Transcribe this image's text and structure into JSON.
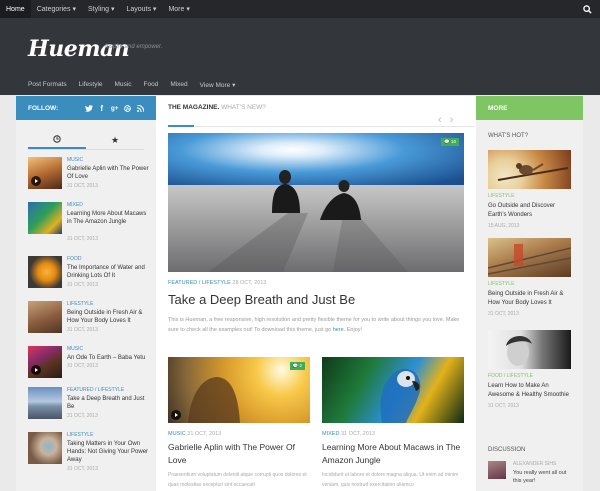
{
  "topnav": {
    "items": [
      {
        "label": "Home",
        "active": true
      },
      {
        "label": "Categories ▾"
      },
      {
        "label": "Styling ▾"
      },
      {
        "label": "Layouts ▾"
      },
      {
        "label": "More ▾"
      }
    ]
  },
  "header": {
    "logo": "Hueman",
    "tagline": "Inspire and empower.",
    "subnav": [
      "Post Formats",
      "Lifestyle",
      "Music",
      "Food",
      "Mixed",
      "View More ▾"
    ]
  },
  "left": {
    "follow_label": "FOLLOW:",
    "posts": [
      {
        "cat": "Music",
        "title": "Gabrielle Aplin with The Power Of Love",
        "date": "31 OCT, 2013",
        "video": true
      },
      {
        "cat": "Mixed",
        "title": "Learning More About Macaws in The Amazon Jungle",
        "date": "31 OCT, 2013"
      },
      {
        "cat": "Food",
        "title": "The Importance of Water and Drinking Lots Of It",
        "date": "31 OCT, 2013"
      },
      {
        "cat": "Lifestyle",
        "title": "Being Outside in Fresh Air & How Your Body Loves It",
        "date": "31 OCT, 2013"
      },
      {
        "cat": "Music",
        "title": "An Ode To Earth – Baba Yetu",
        "date": "31 OCT, 2013",
        "video": true
      },
      {
        "cat": "Featured / Lifestyle",
        "title": "Take a Deep Breath and Just Be",
        "date": "31 OCT, 2013"
      },
      {
        "cat": "Lifestyle",
        "title": "Taking Matters in Your Own Hands: Not Giving Your Power Away",
        "date": "31 OCT, 2013"
      }
    ]
  },
  "main": {
    "heading_bold": "THE MAGAZINE.",
    "heading_light": " WHAT'S NEW?",
    "featured": {
      "comments": "10",
      "cat": "FEATURED / LIFESTYLE",
      "date": " 28 OCT, 2013",
      "title": "Take a Deep Breath and Just Be",
      "excerpt": "This is Hueman, a free responsive, high resolution and pretty flexible theme for you to write about things you love. Make sure to check all the examples out! To download this theme, just go ",
      "excerpt_link": "here",
      "excerpt_end": ". Enjoy!"
    },
    "cards": [
      {
        "comments": "2",
        "cat": "MUSIC",
        "date": " 31 OCT, 2013",
        "title": "Gabrielle Aplin with The Power Of Love",
        "excerpt": "Praesentium voluptatum deleniti atque corrupti quos dolores et quas molestias excepturi sint occaecati"
      },
      {
        "cat": "MIXED",
        "date": " 31 OCT, 2013",
        "title": "Learning More About Macaws in The Amazon Jungle",
        "excerpt": "Incididunt ut labore et dolore magna aliqua. Ut enim ad minim veniam, quis nostrud exercitation ullamco"
      }
    ]
  },
  "right": {
    "more_label": "MORE",
    "whatshot": "WHAT'S HOT?",
    "posts": [
      {
        "cat": "Lifestyle",
        "title": "Go Outside and Discover Earth's Wonders",
        "date": "15 AUG, 2013"
      },
      {
        "cat": "Lifestyle",
        "title": "Being Outside in Fresh Air & How Your Body Loves It",
        "date": "31 OCT, 2013"
      },
      {
        "cat": "Food / Lifestyle",
        "title": "Learn How to Make An Awesome & Healthy Smoothie",
        "date": "31 OCT, 2013"
      }
    ],
    "discussion": "DISCUSSION",
    "disc_author": "ALEXANDER SIHS",
    "disc_text": "You really went all out this year!"
  }
}
